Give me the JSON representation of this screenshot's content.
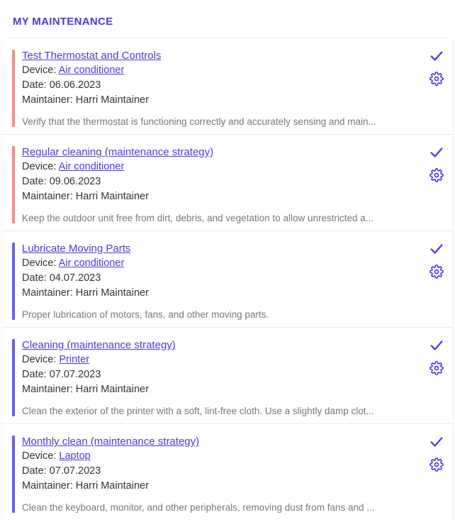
{
  "header": {
    "title": "MY MAINTENANCE"
  },
  "labels": {
    "device_prefix": "Device: ",
    "date_prefix": "Date: ",
    "maintainer_prefix": "Maintainer: "
  },
  "colors": {
    "accent": "#5138d8",
    "accent_bar_overdue": "#f48a8a",
    "accent_bar_normal": "#6a62e2"
  },
  "items": [
    {
      "title": "Test Thermostat and Controls",
      "device": "Air conditioner",
      "date": "06.06.2023",
      "maintainer": "Harri Maintainer",
      "description": "Verify that the thermostat is functioning correctly and accurately sensing and main...",
      "accent": "red"
    },
    {
      "title": "Regular cleaning (maintenance strategy)",
      "device": "Air conditioner",
      "date": "09.06.2023",
      "maintainer": "Harri Maintainer",
      "description": "Keep the outdoor unit free from dirt, debris, and vegetation to allow unrestricted a...",
      "accent": "red"
    },
    {
      "title": "Lubricate Moving Parts",
      "device": "Air conditioner",
      "date": "04.07.2023",
      "maintainer": "Harri Maintainer",
      "description": "Proper lubrication of motors, fans, and other moving parts.",
      "accent": "blue"
    },
    {
      "title": "Cleaning (maintenance strategy)",
      "device": "Printer",
      "date": "07.07.2023",
      "maintainer": "Harri Maintainer",
      "description": "Clean the exterior of the printer with a soft, lint-free cloth. Use a slightly damp clot...",
      "accent": "blue"
    },
    {
      "title": "Monthly clean (maintenance strategy)",
      "device": "Laptop",
      "date": "07.07.2023",
      "maintainer": "Harri Maintainer",
      "description": "Clean the keyboard, monitor, and other peripherals, removing dust from fans and ...",
      "accent": "blue"
    }
  ]
}
